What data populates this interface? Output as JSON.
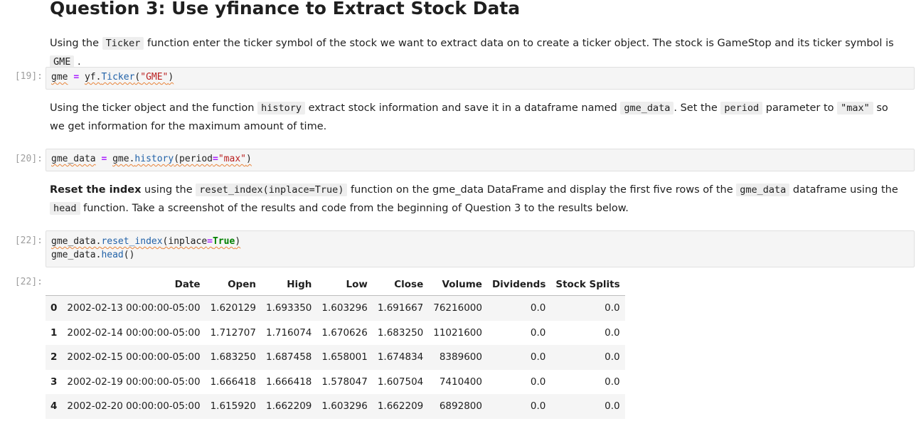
{
  "heading": "Question 3: Use yfinance to Extract Stock Data",
  "md1": {
    "t1": "Using the ",
    "c1": "Ticker",
    "t2": " function enter the ticker symbol of the stock we want to extract data on to create a ticker object. The stock is GameStop and its ticker symbol is ",
    "c2": "GME",
    "t3": " ."
  },
  "cell19": {
    "prompt": "[19]:",
    "var": "gme",
    "op": "=",
    "obj": "yf.",
    "fn": "Ticker",
    "p1": "(",
    "str": "\"GME\"",
    "p2": ")"
  },
  "md2": {
    "t1": "Using the ticker object and the function ",
    "c1": "history",
    "t2": " extract stock information and save it in a dataframe named ",
    "c2": "gme_data",
    "t3": ". Set the ",
    "c3": "period",
    "t4": " parameter to ",
    "c4": "\"max\"",
    "t5": " so we get information for the maximum amount of time."
  },
  "cell20": {
    "prompt": "[20]:",
    "var": "gme_data",
    "op": "=",
    "obj": "gme.",
    "fn": "history",
    "arg": "(period",
    "op2": "=",
    "str": "\"max\"",
    "p2": ")"
  },
  "md3": {
    "bold": "Reset the index",
    "t1": " using the ",
    "c1": "reset_index(inplace=True)",
    "t2": " function on the gme_data DataFrame and display the first five rows of the ",
    "c2": "gme_data",
    "t3": " dataframe using the ",
    "c3": "head",
    "t4": " function. Take a screenshot of the results and code from the beginning of Question 3 to the results below."
  },
  "cell22": {
    "prompt": "[22]:",
    "l1_obj": "gme_data.",
    "l1_fn": "reset_index",
    "l1_arg": "(inplace",
    "l1_op": "=",
    "l1_kw": "True",
    "l1_end": ")",
    "l2_obj": "gme_data.",
    "l2_fn": "head",
    "l2_end": "()"
  },
  "output22": {
    "prompt": "[22]:",
    "columns": [
      "",
      "Date",
      "Open",
      "High",
      "Low",
      "Close",
      "Volume",
      "Dividends",
      "Stock Splits"
    ],
    "rows": [
      [
        "0",
        "2002-02-13 00:00:00-05:00",
        "1.620129",
        "1.693350",
        "1.603296",
        "1.691667",
        "76216000",
        "0.0",
        "0.0"
      ],
      [
        "1",
        "2002-02-14 00:00:00-05:00",
        "1.712707",
        "1.716074",
        "1.670626",
        "1.683250",
        "11021600",
        "0.0",
        "0.0"
      ],
      [
        "2",
        "2002-02-15 00:00:00-05:00",
        "1.683250",
        "1.687458",
        "1.658001",
        "1.674834",
        "8389600",
        "0.0",
        "0.0"
      ],
      [
        "3",
        "2002-02-19 00:00:00-05:00",
        "1.666418",
        "1.666418",
        "1.578047",
        "1.607504",
        "7410400",
        "0.0",
        "0.0"
      ],
      [
        "4",
        "2002-02-20 00:00:00-05:00",
        "1.615920",
        "1.662209",
        "1.603296",
        "1.662209",
        "6892800",
        "0.0",
        "0.0"
      ]
    ]
  }
}
